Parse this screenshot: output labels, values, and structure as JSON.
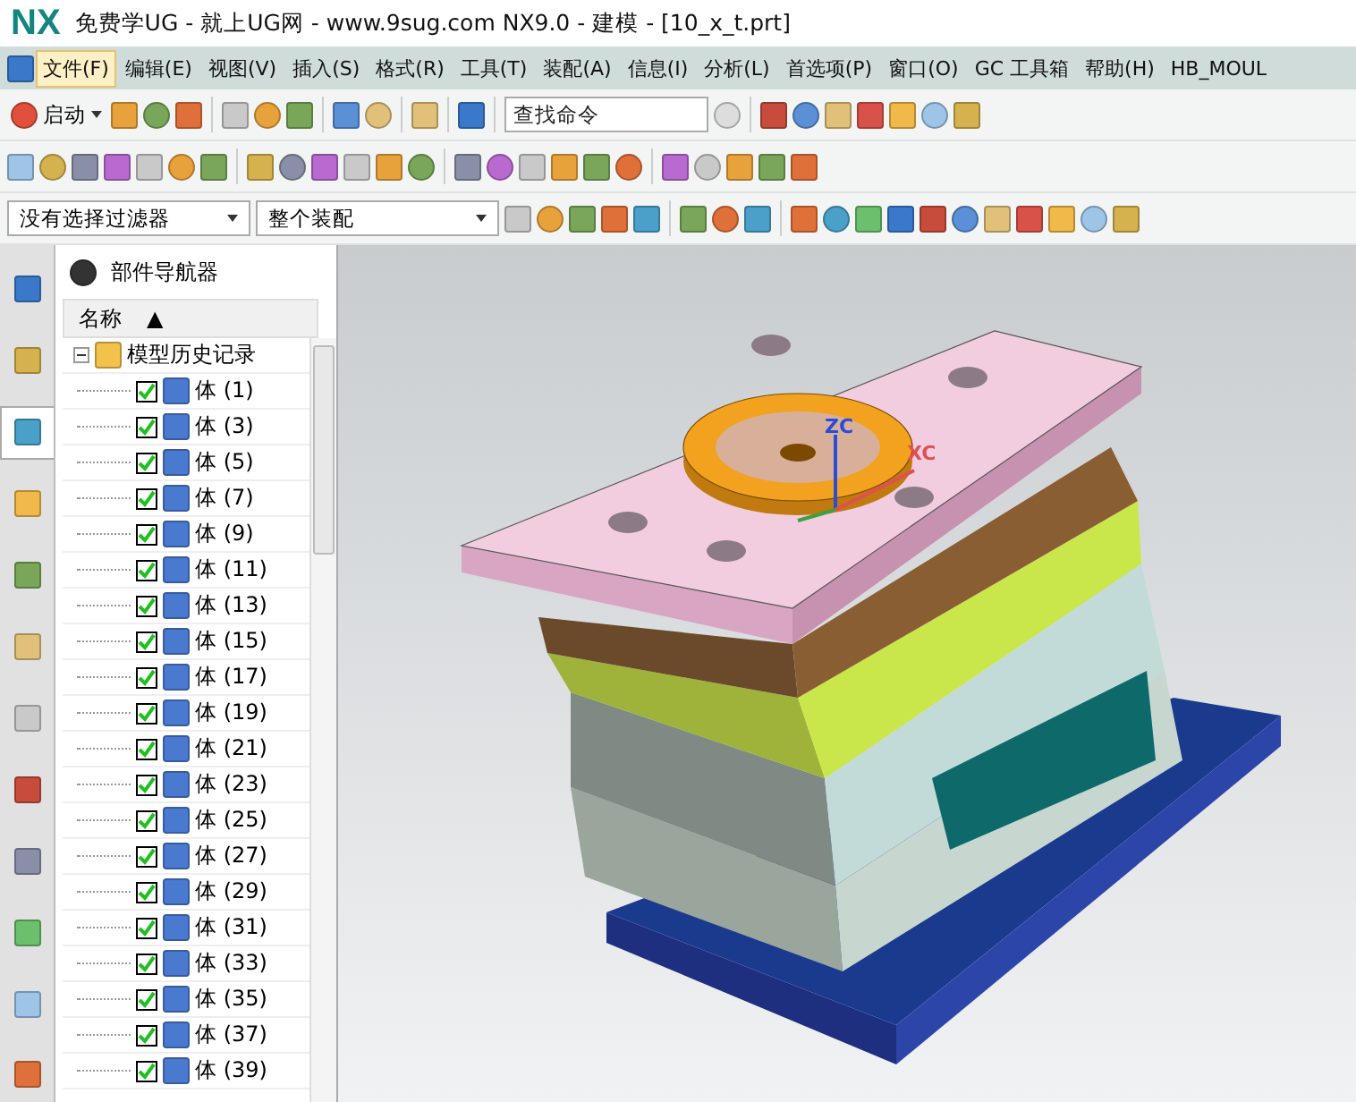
{
  "window": {
    "logo": "NX",
    "title": "免费学UG - 就上UG网 - www.9sug.com NX9.0 - 建模 - [10_x_t.prt]"
  },
  "menu": [
    {
      "label": "文件(F)",
      "selected": true
    },
    {
      "label": "编辑(E)",
      "selected": false
    },
    {
      "label": "视图(V)",
      "selected": false
    },
    {
      "label": "插入(S)",
      "selected": false
    },
    {
      "label": "格式(R)",
      "selected": false
    },
    {
      "label": "工具(T)",
      "selected": false
    },
    {
      "label": "装配(A)",
      "selected": false
    },
    {
      "label": "信息(I)",
      "selected": false
    },
    {
      "label": "分析(L)",
      "selected": false
    },
    {
      "label": "首选项(P)",
      "selected": false
    },
    {
      "label": "窗口(O)",
      "selected": false
    },
    {
      "label": "GC 工具箱",
      "selected": false
    },
    {
      "label": "帮助(H)",
      "selected": false
    },
    {
      "label": "HB_MOUL",
      "selected": false
    }
  ],
  "toolbar": {
    "start_label": "启动",
    "search": {
      "placeholder": "查找命令"
    }
  },
  "selection_bar": {
    "filter": "没有选择过滤器",
    "scope": "整个装配"
  },
  "side_tabs": [
    {
      "selected": false
    },
    {
      "selected": false
    },
    {
      "selected": true
    },
    {
      "selected": false
    },
    {
      "selected": false
    },
    {
      "selected": false
    },
    {
      "selected": false
    },
    {
      "selected": false
    },
    {
      "selected": false
    },
    {
      "selected": false
    },
    {
      "selected": false
    },
    {
      "selected": false
    }
  ],
  "navigator": {
    "title": "部件导航器",
    "column": "名称",
    "sort_indicator": "▲",
    "tree": [
      {
        "label": "模型历史记录",
        "expanded": true,
        "children": [
          {
            "label": "体 (1)",
            "checked": true
          },
          {
            "label": "体 (3)",
            "checked": true
          },
          {
            "label": "体 (5)",
            "checked": true
          },
          {
            "label": "体 (7)",
            "checked": true
          },
          {
            "label": "体 (9)",
            "checked": true
          },
          {
            "label": "体 (11)",
            "checked": true
          },
          {
            "label": "体 (13)",
            "checked": true
          },
          {
            "label": "体 (15)",
            "checked": true
          },
          {
            "label": "体 (17)",
            "checked": true
          },
          {
            "label": "体 (19)",
            "checked": true
          },
          {
            "label": "体 (21)",
            "checked": true
          },
          {
            "label": "体 (23)",
            "checked": true
          },
          {
            "label": "体 (25)",
            "checked": true
          },
          {
            "label": "体 (27)",
            "checked": true
          },
          {
            "label": "体 (29)",
            "checked": true
          },
          {
            "label": "体 (31)",
            "checked": true
          },
          {
            "label": "体 (33)",
            "checked": true
          },
          {
            "label": "体 (35)",
            "checked": true
          },
          {
            "label": "体 (37)",
            "checked": true
          },
          {
            "label": "体 (39)",
            "checked": true
          }
        ]
      }
    ]
  },
  "viewport": {
    "axis_labels": [
      {
        "kind": "z",
        "label": "ZC"
      },
      {
        "kind": "x",
        "label": "XC"
      }
    ]
  }
}
